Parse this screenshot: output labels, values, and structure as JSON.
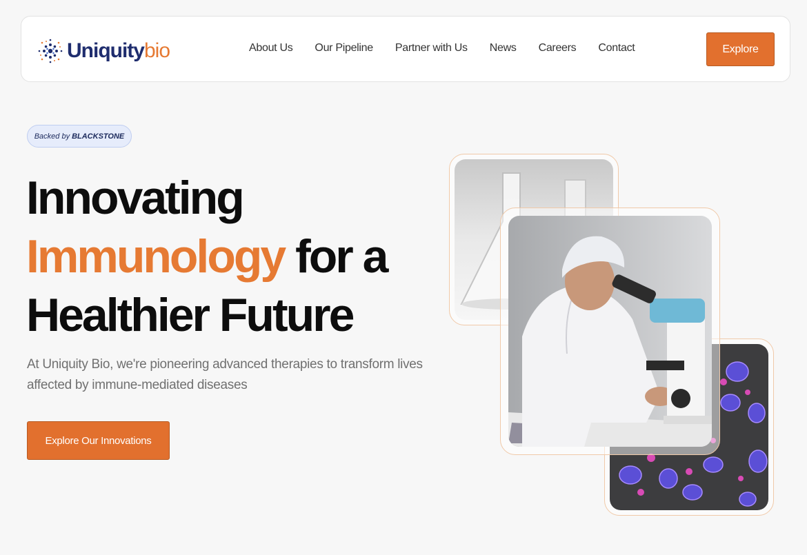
{
  "brand": {
    "name_part1": "Uniquity",
    "name_part2": "bio",
    "logo_icon": "starburst-logo-icon"
  },
  "nav": {
    "links": [
      "About Us",
      "Our Pipeline",
      "Partner with Us",
      "News",
      "Careers",
      "Contact"
    ],
    "cta_label": "Explore"
  },
  "hero": {
    "badge_prefix": "Backed by",
    "badge_brand": "BLACKSTONE",
    "headline_line1": "Innovating",
    "headline_accent": "Immunology",
    "headline_line2_rest": " for a",
    "headline_line3": "Healthier Future",
    "subtext": "At Uniquity Bio, we're pioneering advanced therapies to transform lives affected by immune-mediated diseases",
    "cta_label": "Explore Our Innovations"
  },
  "images": {
    "top": "lab-glassware-photo",
    "center": "scientist-microscope-photo",
    "bottom": "fluorescent-cells-photo"
  },
  "colors": {
    "accent": "#e67a33",
    "button": "#e2702e",
    "navy": "#1f2d6e",
    "badge_bg": "#e6ecfb"
  }
}
